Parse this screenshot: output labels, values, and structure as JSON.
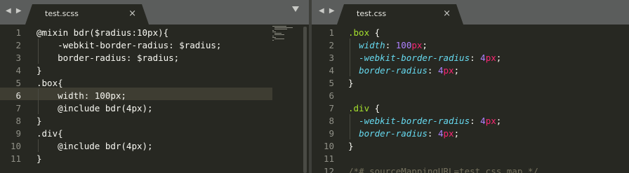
{
  "left_pane": {
    "nav_arrows": "◀ ▶",
    "tab_label": "test.scss",
    "tab_close": "×",
    "dropdown_icon": "chevron-down-icon",
    "lines": [
      "@mixin bdr($radius:10px){",
      "    -webkit-border-radius: $radius;",
      "    border-radius: $radius;",
      "}",
      ".box{",
      "    width: 100px;",
      "    @include bdr(4px);",
      "}",
      ".div{",
      "    @include bdr(4px);",
      "}"
    ],
    "line_numbers": [
      "1",
      "2",
      "3",
      "4",
      "5",
      "6",
      "7",
      "8",
      "9",
      "10",
      "11"
    ],
    "current_line": "6"
  },
  "right_pane": {
    "nav_arrows": "◀ ▶",
    "tab_label": "test.css",
    "tab_close": "×",
    "line_numbers": [
      "1",
      "2",
      "3",
      "4",
      "5",
      "6",
      "7",
      "8",
      "9",
      "10",
      "11",
      "12"
    ],
    "lines": [
      {
        "sel": ".box",
        "rest": " {"
      },
      {
        "prop": "width",
        "num": "100",
        "unit": "px"
      },
      {
        "prop": "-webkit-border-radius",
        "num": "4",
        "unit": "px"
      },
      {
        "prop": "border-radius",
        "num": "4",
        "unit": "px"
      },
      {
        "close": "}"
      },
      {
        "blank": ""
      },
      {
        "sel": ".div",
        "rest": " {"
      },
      {
        "prop": "-webkit-border-radius",
        "num": "4",
        "unit": "px"
      },
      {
        "prop": "border-radius",
        "num": "4",
        "unit": "px"
      },
      {
        "close": "}"
      },
      {
        "blank": ""
      },
      {
        "comment": "/*# sourceMappingURL=test.css.map */"
      }
    ]
  },
  "colors": {
    "background": "#272822",
    "tabbar": "#5b5d5c",
    "selector": "#a6e22e",
    "property": "#66d9ef",
    "number": "#ae81ff",
    "unit": "#f92672",
    "comment": "#75715e"
  }
}
